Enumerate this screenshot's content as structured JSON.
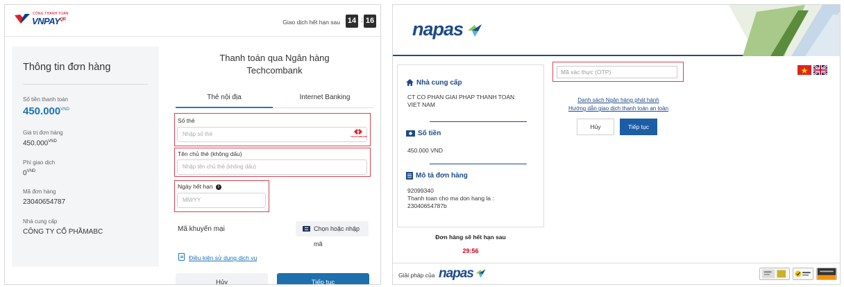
{
  "vnpay": {
    "logo_small": "CỔNG THANH TOÁN",
    "logo_main": "VNPAY",
    "logo_qr": "QR",
    "timer_label": "Giao dịch hết hạn sau",
    "timer_minutes": "14",
    "timer_sep": ":",
    "timer_seconds": "16",
    "order_info": {
      "title": "Thông tin đơn hàng",
      "amount_label": "Số tiền thanh toán",
      "amount_value": "450.000",
      "currency": "VND",
      "order_value_label": "Giá trị đơn hàng",
      "order_value": "450.000",
      "fee_label": "Phí giao dịch",
      "fee_value": "0",
      "order_id_label": "Mã đơn hàng",
      "order_id": "23040654787",
      "provider_label": "Nhà cung cấp",
      "provider": "CÔNG TY CỔ PHẦMABC"
    },
    "main": {
      "heading_line1": "Thanh toán qua Ngân hàng",
      "heading_line2": "Techcombank",
      "tabs": [
        {
          "label": "Thẻ nội địa"
        },
        {
          "label": "Internet Banking"
        }
      ],
      "card_number_label": "Số thẻ",
      "card_number_placeholder": "Nhập số thẻ",
      "bank_logo_text": "TECHCOMBANK",
      "holder_label": "Tên chủ thẻ (không dấu)",
      "holder_placeholder": "Nhập tên chủ thẻ (không dấu)",
      "expiry_label": "Ngày hết hạn",
      "expiry_info": "i",
      "expiry_placeholder": "MM/YY",
      "promo_label": "Mã khuyến mại",
      "promo_button": "Chọn hoặc nhập mã",
      "terms_link": "Điều kiện sử dụng dịch vụ",
      "cancel_button": "Hủy",
      "continue_button": "Tiếp tục"
    },
    "colors": {
      "accent": "#1d6fae",
      "highlight": "#d8424f",
      "amount": "#1a73b8"
    }
  },
  "napas": {
    "logo": "napas",
    "otp_placeholder": "Mã xác thực (OTP)",
    "link_banks": "Danh sách Ngân hàng phát hành",
    "link_guide": "Hướng dẫn giao dịch thanh toán an toàn",
    "cancel_button": "Hủy",
    "continue_button": "Tiếp tục",
    "provider_title": "Nhà cung cấp",
    "provider_line1": "CT CO PHAN GIAI PHAP THANH TOAN",
    "provider_line2": "VIET NAM",
    "amount_title": "Số tiền",
    "amount_value": "450.000 VND",
    "desc_title": "Mô tả đơn hàng",
    "desc_line1": "92099340",
    "desc_line2": "Thanh toan cho ma don hang la :",
    "desc_line3": "23040654787b",
    "expire_label": "Đơn hàng sẽ hết hạn sau",
    "expire_value": "29:56",
    "footer_by": "Giải pháp của",
    "colors": {
      "brand": "#1c4a8a",
      "timer": "#d0021b"
    }
  }
}
